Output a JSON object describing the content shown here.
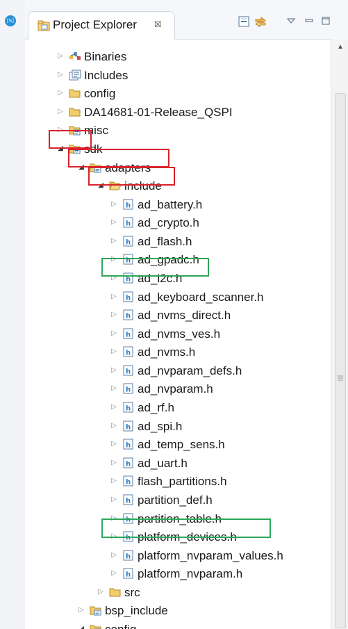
{
  "view": {
    "title": "Project Explorer",
    "close_glyph": "☒"
  },
  "gutter": {
    "badge": "[S]"
  },
  "colors": {
    "folder": "#e8b84a",
    "highlight_red": "#d9222a",
    "highlight_green": "#2ea65a",
    "header_file": "#2f7cc0"
  },
  "tree": {
    "items": [
      {
        "label": "Binaries",
        "icon": "binaries-icon",
        "expanded": false
      },
      {
        "label": "Includes",
        "icon": "includes-icon",
        "expanded": false
      },
      {
        "label": "config",
        "icon": "folder-icon",
        "expanded": false
      },
      {
        "label": "DA14681-01-Release_QSPI",
        "icon": "folder-icon",
        "expanded": false
      },
      {
        "label": "misc",
        "icon": "source-folder-icon",
        "expanded": false
      },
      {
        "label": "sdk",
        "icon": "source-folder-icon",
        "expanded": true
      },
      {
        "label": "adapters",
        "icon": "source-folder-icon",
        "expanded": true
      },
      {
        "label": "include",
        "icon": "open-folder-icon",
        "expanded": true
      },
      {
        "label": "ad_battery.h",
        "icon": "header-file-icon",
        "expanded": false
      },
      {
        "label": "ad_crypto.h",
        "icon": "header-file-icon",
        "expanded": false
      },
      {
        "label": "ad_flash.h",
        "icon": "header-file-icon",
        "expanded": false
      },
      {
        "label": "ad_gpadc.h",
        "icon": "header-file-icon",
        "expanded": false
      },
      {
        "label": "ad_i2c.h",
        "icon": "header-file-icon",
        "expanded": false
      },
      {
        "label": "ad_keyboard_scanner.h",
        "icon": "header-file-icon",
        "expanded": false
      },
      {
        "label": "ad_nvms_direct.h",
        "icon": "header-file-icon",
        "expanded": false
      },
      {
        "label": "ad_nvms_ves.h",
        "icon": "header-file-icon",
        "expanded": false
      },
      {
        "label": "ad_nvms.h",
        "icon": "header-file-icon",
        "expanded": false
      },
      {
        "label": "ad_nvparam_defs.h",
        "icon": "header-file-icon",
        "expanded": false
      },
      {
        "label": "ad_nvparam.h",
        "icon": "header-file-icon",
        "expanded": false
      },
      {
        "label": "ad_rf.h",
        "icon": "header-file-icon",
        "expanded": false
      },
      {
        "label": "ad_spi.h",
        "icon": "header-file-icon",
        "expanded": false
      },
      {
        "label": "ad_temp_sens.h",
        "icon": "header-file-icon",
        "expanded": false
      },
      {
        "label": "ad_uart.h",
        "icon": "header-file-icon",
        "expanded": false
      },
      {
        "label": "flash_partitions.h",
        "icon": "header-file-icon",
        "expanded": false
      },
      {
        "label": "partition_def.h",
        "icon": "header-file-icon",
        "expanded": false
      },
      {
        "label": "partition_table.h",
        "icon": "header-file-icon",
        "expanded": false
      },
      {
        "label": "platform_devices.h",
        "icon": "header-file-icon",
        "expanded": false
      },
      {
        "label": "platform_nvparam_values.h",
        "icon": "header-file-icon",
        "expanded": false
      },
      {
        "label": "platform_nvparam.h",
        "icon": "header-file-icon",
        "expanded": false
      },
      {
        "label": "src",
        "icon": "folder-icon",
        "expanded": false
      },
      {
        "label": "bsp_include",
        "icon": "source-folder-icon",
        "expanded": false
      },
      {
        "label": "config",
        "icon": "source-folder-icon",
        "expanded": true
      }
    ]
  }
}
